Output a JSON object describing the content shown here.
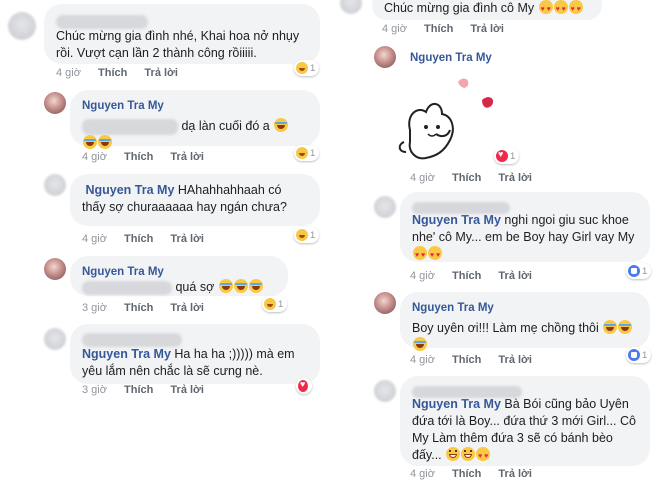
{
  "names": {
    "nguyen": "Nguyen Tra My"
  },
  "actions": {
    "like": "Thích",
    "reply": "Trả lời"
  },
  "left": {
    "c1": {
      "text": "Chúc mừng gia đình nhé, Khai hoa nở nhụy rồi. Vượt cạn lần 2 thành công rồiiiii.",
      "time": "4 giờ",
      "react_count": "1"
    },
    "c2": {
      "text": "dạ làn cuối đó a",
      "time": "4 giờ",
      "react_count": "1"
    },
    "c3": {
      "text": "HAhahhahhaah có thấy sợ churaaaaaa hay ngán chưa?",
      "time": "4 giờ",
      "react_count": "1"
    },
    "c4": {
      "text": "quá sợ",
      "time": "3 giờ",
      "react_count": "1"
    },
    "c5": {
      "text": "Ha ha ha ;))))) mà em yêu lắm nên chắc là sẽ cưng nè.",
      "time": "3 giờ"
    }
  },
  "right": {
    "c1": {
      "text": "Chúc mừng gia đình cô My",
      "time": "4 giờ"
    },
    "c2": {
      "time": "4 giờ",
      "react_count": "1"
    },
    "c3": {
      "text": "nghi ngoi giu suc khoe nhe' cô My... em be Boy hay Girl vay My",
      "time": "4 giờ",
      "react_count": "1"
    },
    "c4": {
      "text": "Boy uyên ơi!!! Làm mẹ chồng thôi",
      "time": "4 giờ",
      "react_count": "1"
    },
    "c5": {
      "text": "Bà Bói cũng bảo Uyên đứa tới là Boy... đứa thứ 3 mới Girl... Cô My Làm thêm đứa 3 sẽ có bánh bèo đấy...",
      "time": "4 giờ"
    }
  },
  "colors": {
    "bubble": "#f2f3f5",
    "name": "#365899",
    "meta": "#90949c"
  }
}
